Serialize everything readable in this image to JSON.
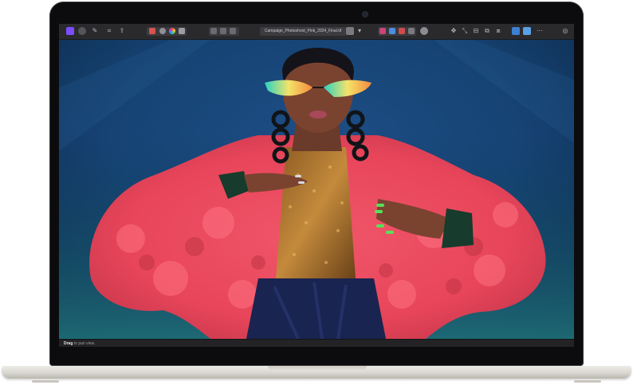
{
  "app": {
    "document_title": "Campaign_Photoshoot_Pink_2024_Final.tif",
    "status_hint_bold": "Drag",
    "status_hint_rest": " to pan view."
  },
  "toolbar": {
    "icons_left": [
      "app-icon",
      "persona-icon",
      "brush-icon",
      "pixel-icon",
      "export-icon"
    ],
    "icons_mid": [
      "layers-icon",
      "contrast-icon",
      "color-icon",
      "grid-icon"
    ],
    "icons_right": [
      "crop-icon",
      "adjust-icon",
      "snapping-icon",
      "assistant-icon",
      "share-icon",
      "user-icon"
    ]
  },
  "colors": {
    "toolbar_bg": "#2a2a2d",
    "accent_purple": "#7b4dff",
    "coat_pink": "#e8455a",
    "background_teal": "#1a4a66"
  }
}
